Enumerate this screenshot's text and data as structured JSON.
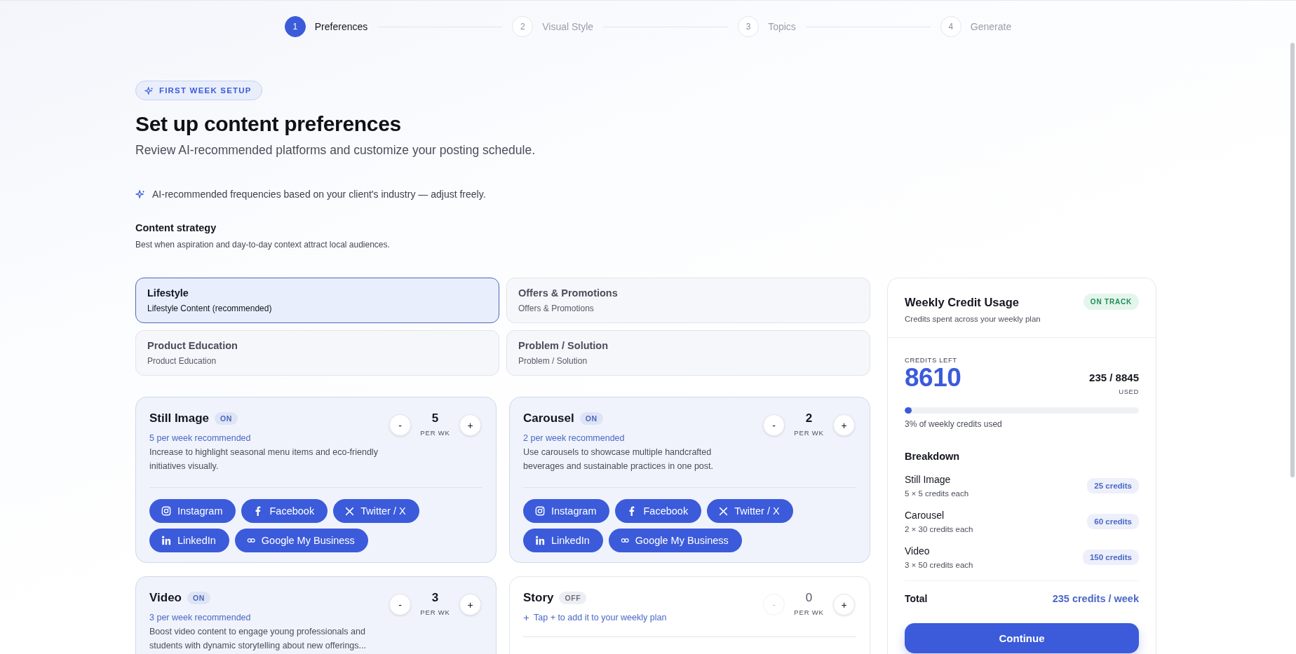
{
  "stepper": {
    "steps": [
      {
        "number": "1",
        "label": "Preferences",
        "selected": true
      },
      {
        "number": "2",
        "label": "Visual Style",
        "selected": false
      },
      {
        "number": "3",
        "label": "Topics",
        "selected": false
      },
      {
        "number": "4",
        "label": "Generate",
        "selected": false
      }
    ]
  },
  "header": {
    "badge": "FIRST WEEK SETUP",
    "title": "Set up content preferences",
    "subtitle": "Review AI-recommended platforms and customize your posting schedule.",
    "ai_note": "AI-recommended frequencies based on your client's industry — adjust freely."
  },
  "content_strategy": {
    "title": "Content strategy",
    "description": "Best when aspiration and day-to-day context attract local audiences.",
    "options": [
      {
        "title": "Lifestyle",
        "subtitle": "Lifestyle Content (recommended)",
        "selected": true
      },
      {
        "title": "Offers & Promotions",
        "subtitle": "Offers & Promotions",
        "selected": false
      },
      {
        "title": "Product Education",
        "subtitle": "Product Education",
        "selected": false
      },
      {
        "title": "Problem / Solution",
        "subtitle": "Problem / Solution",
        "selected": false
      }
    ]
  },
  "formats": [
    {
      "name": "Still Image",
      "status": "ON",
      "on": true,
      "decrement": "-",
      "count": "5",
      "unit": "PER WK",
      "increment": "+",
      "recommendation": "5 per week recommended",
      "description": "Increase to highlight seasonal menu items and eco-friendly initiatives visually.",
      "platforms": [
        {
          "kind": "instagram",
          "label": "Instagram",
          "selected": true
        },
        {
          "kind": "facebook",
          "label": "Facebook",
          "selected": true
        },
        {
          "kind": "x",
          "label": "Twitter / X",
          "selected": true
        },
        {
          "kind": "linkedin",
          "label": "LinkedIn",
          "selected": true
        },
        {
          "kind": "gmb",
          "label": "Google My Business",
          "selected": true
        }
      ]
    },
    {
      "name": "Carousel",
      "status": "ON",
      "on": true,
      "decrement": "-",
      "count": "2",
      "unit": "PER WK",
      "increment": "+",
      "recommendation": "2 per week recommended",
      "description": "Use carousels to showcase multiple handcrafted beverages and sustainable practices in one post.",
      "platforms": [
        {
          "kind": "instagram",
          "label": "Instagram",
          "selected": true
        },
        {
          "kind": "facebook",
          "label": "Facebook",
          "selected": true
        },
        {
          "kind": "x",
          "label": "Twitter / X",
          "selected": true
        },
        {
          "kind": "linkedin",
          "label": "LinkedIn",
          "selected": true
        },
        {
          "kind": "gmb",
          "label": "Google My Business",
          "selected": true
        }
      ]
    },
    {
      "name": "Video",
      "status": "ON",
      "on": true,
      "decrement": "-",
      "count": "3",
      "unit": "PER WK",
      "increment": "+",
      "recommendation": "3 per week recommended",
      "description": "Boost video content to engage young professionals and students with dynamic storytelling about new offerings..."
    },
    {
      "name": "Story",
      "status": "OFF",
      "on": false,
      "decrement": "-",
      "count": "0",
      "unit": "PER WK",
      "increment": "+",
      "recommendation": "Tap + to add it to your weekly plan"
    }
  ],
  "credit_panel": {
    "title": "Weekly Credit Usage",
    "subtitle": "Credits spent across your weekly plan",
    "status": "ON TRACK",
    "credits_left_label": "CREDITS LEFT",
    "credits_left": "8610",
    "used": "235 / 8845",
    "used_label": "USED",
    "usage": {
      "level": 0.03
    },
    "usage_caption": "3% of weekly credits used",
    "breakdown_title": "Breakdown",
    "breakdown": [
      {
        "name": "Still Image",
        "detail": "5 × 5 credits each",
        "credits": "25 credits"
      },
      {
        "name": "Carousel",
        "detail": "2 × 30 credits each",
        "credits": "60 credits"
      },
      {
        "name": "Video",
        "detail": "3 × 50 credits each",
        "credits": "150 credits"
      }
    ],
    "total_label": "Total",
    "total_value": "235 credits / week",
    "button": "Continue"
  }
}
